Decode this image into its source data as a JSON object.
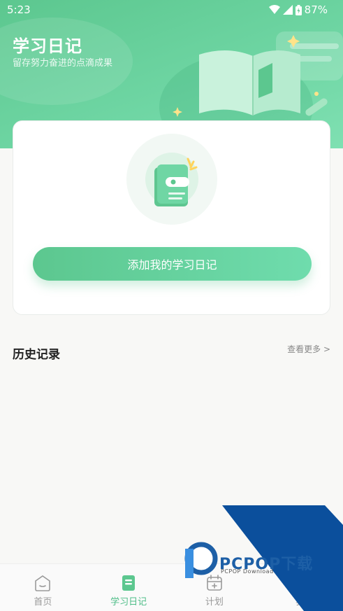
{
  "status_bar": {
    "time": "5:23",
    "battery": "87%"
  },
  "header": {
    "title": "学习日记",
    "subtitle": "留存努力奋进的点滴成果"
  },
  "card": {
    "add_button_label": "添加我的学习日记"
  },
  "history": {
    "title": "历史记录",
    "view_more": "查看更多 >"
  },
  "tabbar": {
    "tabs": [
      {
        "label": "首页",
        "icon": "home-icon"
      },
      {
        "label": "学习日记",
        "icon": "diary-icon",
        "active": true
      },
      {
        "label": "计划",
        "icon": "calendar-icon"
      },
      {
        "label": "我",
        "icon": "profile-icon"
      }
    ]
  },
  "watermark": {
    "text": "PCPOP下载",
    "sub": "PCPOP Download"
  },
  "colors": {
    "accent": "#5cc78f",
    "accent_light": "#6fdcad"
  }
}
